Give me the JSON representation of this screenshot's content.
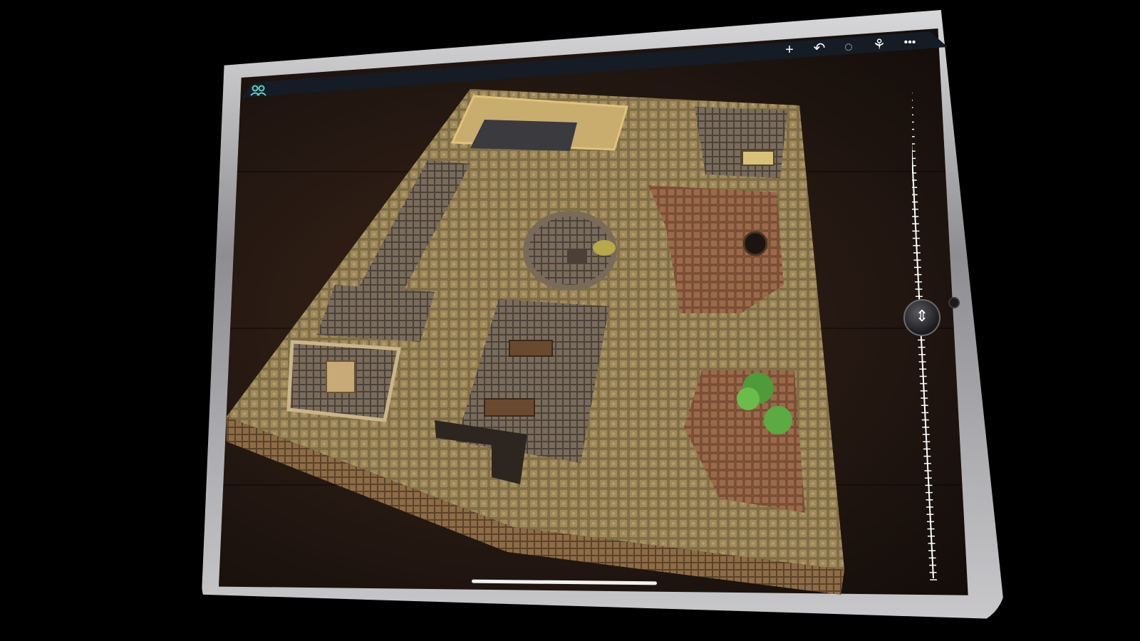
{
  "toolbar": {
    "icons": [
      "add-icon",
      "undo-icon",
      "lasso-icon",
      "share-icon",
      "more-icon"
    ],
    "glyphs": [
      "+",
      "↶",
      "◌",
      "⚘",
      "•••"
    ]
  },
  "players": {
    "icon": "users-icon",
    "color": "#57d1c9"
  },
  "height_slider": {
    "icon": "vertical-move-icon",
    "glyph": "⇕"
  },
  "colors": {
    "background": "#000000",
    "bezel": "#0c0c0e",
    "accent": "#57d1c9",
    "floor": "#8b7a52",
    "wall": "#b39a6a"
  }
}
